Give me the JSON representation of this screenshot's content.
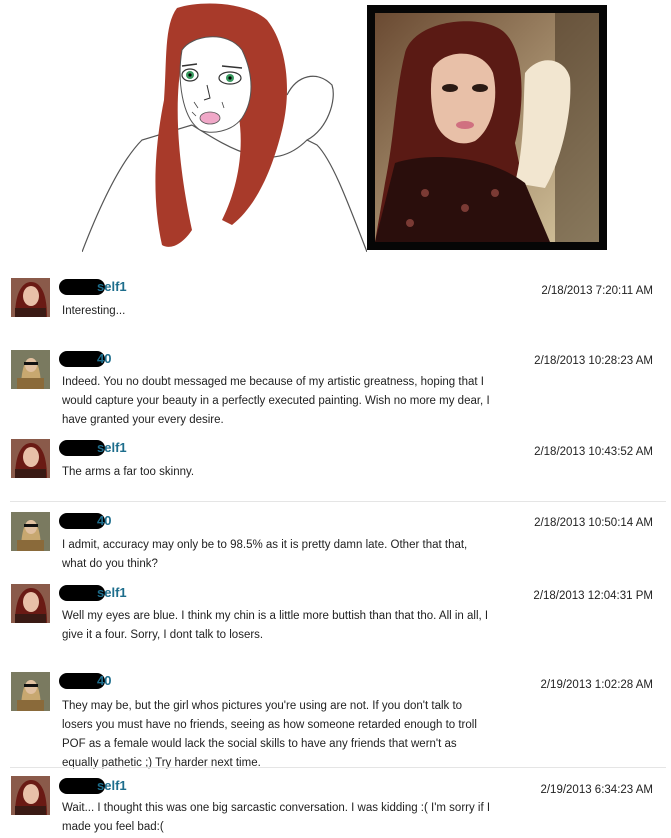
{
  "messages": [
    {
      "avatar": "female",
      "name": "self1",
      "time": "2/18/2013 7:20:11 AM",
      "text": "Interesting..."
    },
    {
      "avatar": "male",
      "name": "40",
      "time": "2/18/2013 10:28:23 AM",
      "text": "Indeed. You no doubt messaged me because of my artistic greatness, hoping that I would capture your beauty in a perfectly executed painting. Wish no more my dear, I have granted your every desire."
    },
    {
      "avatar": "female",
      "name": "self1",
      "time": "2/18/2013 10:43:52 AM",
      "text": "The arms a far too skinny."
    },
    {
      "avatar": "male",
      "name": "40",
      "time": "2/18/2013 10:50:14 AM",
      "text": "I admit, accuracy may only be to 98.5% as it is pretty damn late. Other that that, what do you think?"
    },
    {
      "avatar": "female",
      "name": "self1",
      "time": "2/18/2013 12:04:31 PM",
      "text": "Well my eyes are blue. I think my chin is a little more buttish than that tho. All in all, I give it a four. Sorry, I dont talk to losers."
    },
    {
      "avatar": "male",
      "name": "40",
      "time": "2/19/2013 1:02:28 AM",
      "text": "They may be, but the girl whos pictures you're using are not. If you don't talk to losers you must have no friends, seeing as how someone retarded enough to troll POF as a female would lack the social skills to have any friends that wern't as equally pathetic ;) Try harder next time."
    },
    {
      "avatar": "female",
      "name": "self1",
      "time": "2/19/2013 6:34:23 AM",
      "text": "Wait... I thought this was one big sarcastic conversation. I was kidding :( I'm sorry if I made you feel bad:("
    }
  ]
}
